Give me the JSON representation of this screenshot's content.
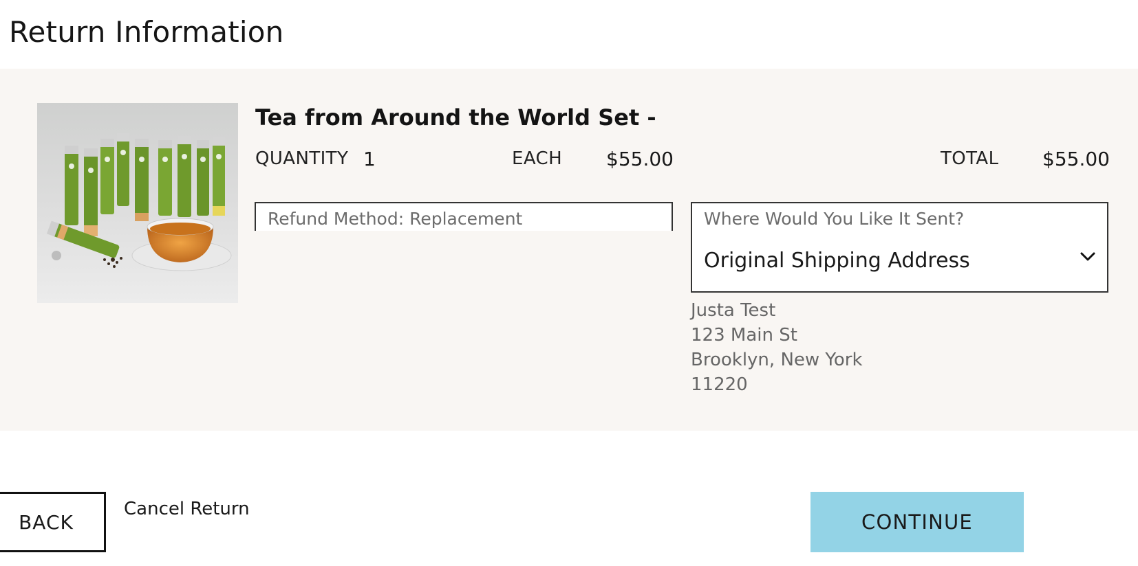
{
  "page_title": "Return Information",
  "product": {
    "name": "Tea from Around the World Set -",
    "image_icon": "tea-set-photo",
    "quantity_label": "QUANTITY",
    "quantity_value": "1",
    "each_label": "EACH",
    "each_value": "$55.00",
    "total_label": "TOTAL",
    "total_value": "$55.00"
  },
  "refund_method": {
    "text": "Refund Method: Replacement"
  },
  "shipping_select": {
    "caption": "Where Would You Like It Sent?",
    "selected": "Original Shipping Address",
    "icon": "chevron-down-icon"
  },
  "address": {
    "name": "Justa Test",
    "street": "123 Main St",
    "city_state": "Brooklyn, New York",
    "zip": "11220"
  },
  "actions": {
    "back_label": "BACK",
    "cancel_label": "Cancel Return",
    "continue_label": "CONTINUE"
  },
  "colors": {
    "panel_background": "#f9f6f3",
    "continue_button": "#93d3e6",
    "tea_tube_green": "#6f9a2c"
  }
}
